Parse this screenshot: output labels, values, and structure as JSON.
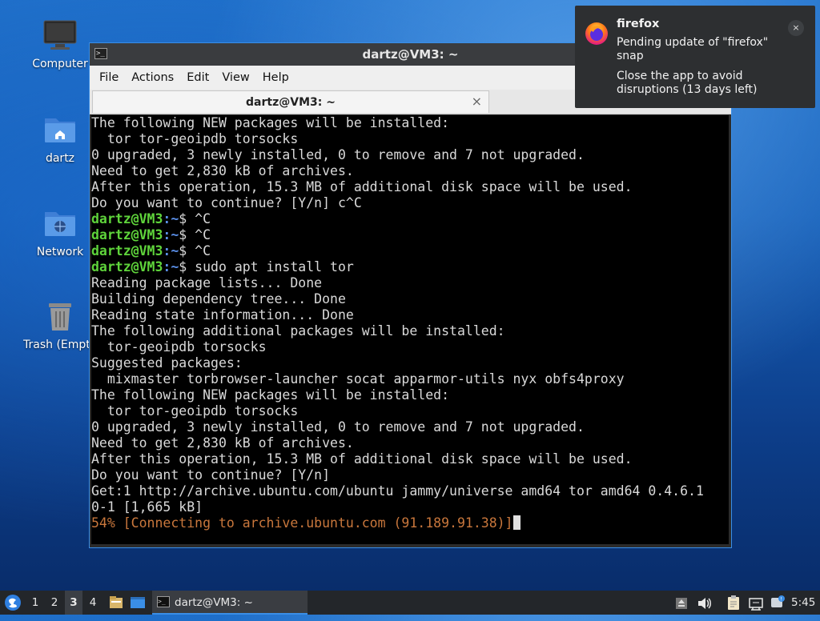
{
  "desktop": {
    "icons": [
      {
        "label": "Computer"
      },
      {
        "label": "dartz"
      },
      {
        "label": "Network"
      },
      {
        "label": "Trash (Empty)"
      }
    ]
  },
  "window": {
    "title": "dartz@VM3: ~",
    "menu": [
      "File",
      "Actions",
      "Edit",
      "View",
      "Help"
    ],
    "tab_label": "dartz@VM3: ~",
    "tab_close": "×"
  },
  "terminal": {
    "prompt_user": "dartz@VM3",
    "prompt_path": ":~",
    "lines": {
      "l1": "The following NEW packages will be installed:",
      "l2": "  tor tor-geoipdb torsocks",
      "l3": "0 upgraded, 3 newly installed, 0 to remove and 7 not upgraded.",
      "l4": "Need to get 2,830 kB of archives.",
      "l5": "After this operation, 15.3 MB of additional disk space will be used.",
      "l6": "Do you want to continue? [Y/n] c^C",
      "c1": "$ ^C",
      "c2": "$ ^C",
      "c3": "$ ^C",
      "c4": "$ sudo apt install tor",
      "l7": "Reading package lists... Done",
      "l8": "Building dependency tree... Done",
      "l9": "Reading state information... Done",
      "l10": "The following additional packages will be installed:",
      "l11": "  tor-geoipdb torsocks",
      "l12": "Suggested packages:",
      "l13": "  mixmaster torbrowser-launcher socat apparmor-utils nyx obfs4proxy",
      "l14": "The following NEW packages will be installed:",
      "l15": "  tor tor-geoipdb torsocks",
      "l16": "0 upgraded, 3 newly installed, 0 to remove and 7 not upgraded.",
      "l17": "Need to get 2,830 kB of archives.",
      "l18": "After this operation, 15.3 MB of additional disk space will be used.",
      "l19": "Do you want to continue? [Y/n]",
      "l20": "Get:1 http://archive.ubuntu.com/ubuntu jammy/universe amd64 tor amd64 0.4.6.1",
      "l21": "0-1 [1,665 kB]",
      "l22": "54% [Connecting to archive.ubuntu.com (91.189.91.38)]"
    }
  },
  "notification": {
    "app": "firefox",
    "body1": "Pending update of \"firefox\" snap",
    "body2": "Close the app to avoid disruptions (13 days left)",
    "close": "×"
  },
  "taskbar": {
    "workspaces": [
      "1",
      "2",
      "3",
      "4"
    ],
    "active_workspace": "3",
    "task_label": "dartz@VM3: ~",
    "clock": "5:45"
  },
  "colors": {
    "accent": "#3a8ee6",
    "prompt_user": "#5fd43b",
    "prompt_path": "#5a8fe8",
    "progress": "#c9773c"
  }
}
